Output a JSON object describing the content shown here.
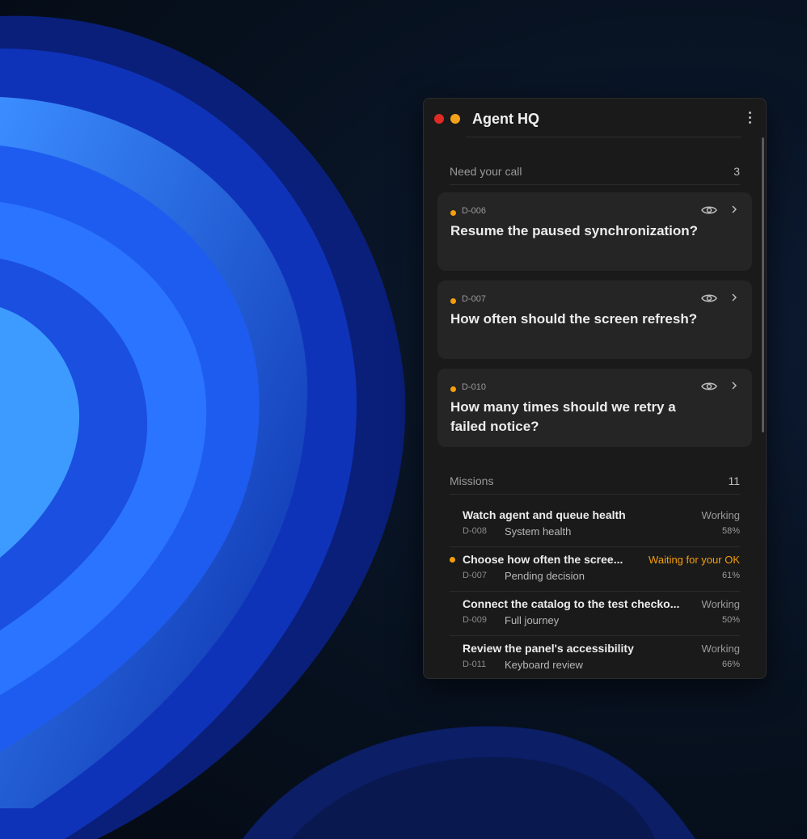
{
  "window": {
    "title": "Agent HQ",
    "close_icon": "red-dot",
    "minimize_icon": "orange-dot",
    "menu_icon": "vertical-ellipsis"
  },
  "colors": {
    "panel_bg": "#1a1a1a",
    "card_bg": "#252525",
    "accent_orange": "#f59e0b",
    "close_red": "#e02a24"
  },
  "decisions": {
    "label": "Need your call",
    "count": "3",
    "items": [
      {
        "id": "D-006",
        "question": "Resume the paused synchronization?",
        "view_icon": "eye-icon",
        "open_icon": "chevron-right-icon"
      },
      {
        "id": "D-007",
        "question": "How often should the screen refresh?",
        "view_icon": "eye-icon",
        "open_icon": "chevron-right-icon"
      },
      {
        "id": "D-010",
        "question": "How many times should we retry a failed notice?",
        "view_icon": "eye-icon",
        "open_icon": "chevron-right-icon"
      }
    ]
  },
  "missions": {
    "label": "Missions",
    "count": "11",
    "items": [
      {
        "title": "Watch agent and queue health",
        "status": "Working",
        "id": "D-008",
        "subtitle": "System health",
        "progress": "58%"
      },
      {
        "title": "Choose how often the scree...",
        "status": "Waiting for your OK",
        "id": "D-007",
        "subtitle": "Pending decision",
        "progress": "61%"
      },
      {
        "title": "Connect the catalog to the test checko...",
        "status": "Working",
        "id": "D-009",
        "subtitle": "Full journey",
        "progress": "50%"
      },
      {
        "title": "Review the panel's accessibility",
        "status": "Working",
        "id": "D-011",
        "subtitle": "Keyboard review",
        "progress": "66%"
      }
    ]
  }
}
